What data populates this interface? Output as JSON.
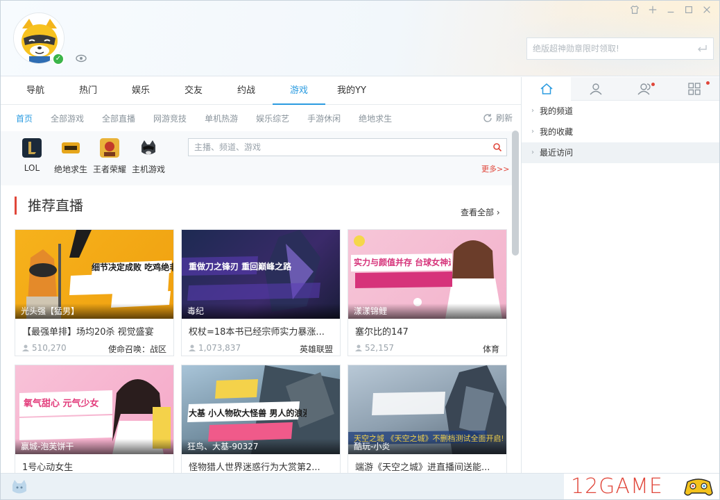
{
  "window": {
    "controls": [
      "shirt-icon",
      "pin-icon",
      "minimize-icon",
      "maximize-icon",
      "close-icon"
    ]
  },
  "header": {
    "promo_placeholder": "绝版超神勋章限时领取!"
  },
  "main_tabs": [
    {
      "label": "导航"
    },
    {
      "label": "热门"
    },
    {
      "label": "娱乐"
    },
    {
      "label": "交友"
    },
    {
      "label": "约战"
    },
    {
      "label": "游戏",
      "active": true
    },
    {
      "label": "我的YY"
    }
  ],
  "sub_tabs": [
    {
      "label": "首页",
      "active": true
    },
    {
      "label": "全部游戏"
    },
    {
      "label": "全部直播"
    },
    {
      "label": "网游竞技"
    },
    {
      "label": "单机热游"
    },
    {
      "label": "娱乐综艺"
    },
    {
      "label": "手游休闲"
    },
    {
      "label": "绝地求生"
    }
  ],
  "refresh_label": "刷新",
  "games": [
    {
      "label": "LOL"
    },
    {
      "label": "绝地求生"
    },
    {
      "label": "王者荣耀"
    },
    {
      "label": "主机游戏"
    }
  ],
  "search": {
    "placeholder": "主播、频道、游戏"
  },
  "more_label": "更多>>",
  "section": {
    "title": "推荐直播",
    "see_all": "查看全部"
  },
  "cards": [
    {
      "thumb_label": "光头强【猛男】",
      "title": "【最强单排】场均20杀 视觉盛宴",
      "viewers": "510,270",
      "category": "使命召唤：战区",
      "art": "细节决定成败 吃鸡绝非偶然 光头强"
    },
    {
      "thumb_label": "毒纪",
      "title": "权杖=18本书已经宗师实力暴涨...",
      "viewers": "1,073,837",
      "category": "英雄联盟",
      "art": "重做刀之锋刃 重回巅峰之路"
    },
    {
      "thumb_label": "漾漾锦鲤",
      "title": "塞尔比的147",
      "viewers": "52,157",
      "category": "体育",
      "art": "实力与颜值并存 台球女神迷人解说"
    },
    {
      "thumb_label": "赢城-泡芙饼干",
      "title": "1号心动女生",
      "viewers": "",
      "category": "",
      "art": "氧气甜心 元气少女"
    },
    {
      "thumb_label": "狂鸟、大基-90327",
      "title": "怪物猎人世界迷惑行为大赏第2...",
      "viewers": "",
      "category": "",
      "art": "大基 小人物砍大怪兽 男人的浪漫"
    },
    {
      "thumb_label": "酷玩-小炎",
      "title": "端游《天空之城》进直播间送能...",
      "viewers": "",
      "category": "",
      "art": "天空之城 《天空之城》不删档测试全面开启!"
    }
  ],
  "right_pane": {
    "tabs": [
      "home-icon",
      "person-icon",
      "friends-icon",
      "apps-icon"
    ],
    "items": [
      {
        "label": "我的频道"
      },
      {
        "label": "我的收藏"
      },
      {
        "label": "最近访问",
        "highlight": true
      }
    ]
  },
  "watermark": "12GAME",
  "colors": {
    "accent": "#2a9be0",
    "red": "#e0463a"
  }
}
